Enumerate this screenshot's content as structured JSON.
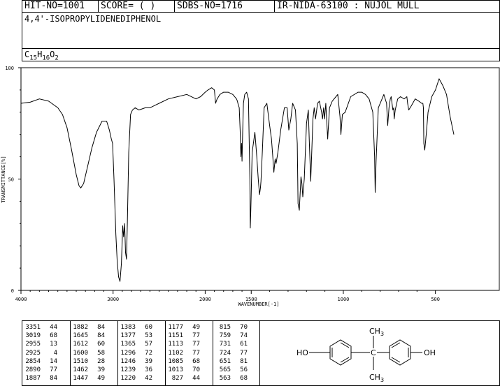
{
  "header": {
    "hit_no": "HIT-NO=1001",
    "score": "SCORE=  (   )",
    "sdbs_no": "SDBS-NO=1716",
    "ir_id": "IR-NIDA-63100 : NUJOL MULL"
  },
  "compound": {
    "name": "4,4'-ISOPROPYLIDENEDIPHENOL",
    "formula_main": "C",
    "formula_sub1": "15",
    "formula_h": "H",
    "formula_sub2": "16",
    "formula_o": "O",
    "formula_sub3": "2"
  },
  "chart_data": {
    "type": "line",
    "xlabel": "WAVENUMBER[-1]",
    "ylabel": "TRANSMITTANCE[%]",
    "xlim": [
      4000,
      400
    ],
    "ylim": [
      0,
      100
    ],
    "x_ticks": [
      4000,
      3000,
      2000,
      1500,
      1000,
      500
    ],
    "y_ticks": [
      0,
      50,
      100
    ],
    "x_tick_labels": [
      "4000",
      "3000",
      "2000",
      "1500",
      "1000",
      "500"
    ],
    "y_tick_labels": [
      "0",
      "50",
      "100"
    ],
    "series": [
      {
        "x": [
          4000,
          3900,
          3800,
          3700,
          3600,
          3550,
          3500,
          3450,
          3400,
          3370,
          3351,
          3320,
          3280,
          3230,
          3180,
          3120,
          3070,
          3040,
          3019,
          3005,
          2990,
          2970,
          2955,
          2940,
          2925,
          2910,
          2895,
          2885,
          2875,
          2865,
          2854,
          2845,
          2830,
          2810,
          2790,
          2760,
          2720,
          2650,
          2600,
          2550,
          2500,
          2400,
          2300,
          2200,
          2100,
          2050,
          2000,
          1970,
          1930,
          1900,
          1887,
          1870,
          1840,
          1800,
          1750,
          1700,
          1660,
          1650,
          1645,
          1630,
          1620,
          1612,
          1605,
          1600,
          1595,
          1585,
          1570,
          1550,
          1530,
          1515,
          1510,
          1505,
          1495,
          1480,
          1470,
          1462,
          1455,
          1450,
          1447,
          1440,
          1430,
          1415,
          1400,
          1390,
          1383,
          1377,
          1370,
          1365,
          1355,
          1340,
          1320,
          1305,
          1296,
          1285,
          1275,
          1260,
          1250,
          1246,
          1239,
          1230,
          1225,
          1220,
          1212,
          1200,
          1190,
          1185,
          1177,
          1165,
          1158,
          1151,
          1140,
          1130,
          1118,
          1113,
          1107,
          1102,
          1095,
          1085,
          1075,
          1060,
          1040,
          1030,
          1018,
          1013,
          1005,
          990,
          960,
          920,
          900,
          880,
          860,
          840,
          830,
          827,
          822,
          810,
          790,
          780,
          765,
          759,
          752,
          745,
          740,
          731,
          726,
          724,
          718,
          705,
          690,
          670,
          655,
          651,
          645,
          630,
          610,
          590,
          575,
          568,
          565,
          563,
          558,
          550,
          540,
          520,
          500,
          480,
          460,
          440,
          420,
          400
        ],
        "y": [
          84,
          84.5,
          86,
          85,
          82,
          79,
          73,
          63,
          52,
          47,
          46,
          48,
          55,
          64,
          71,
          76,
          76,
          72,
          68,
          66,
          50,
          25,
          13,
          6,
          4,
          12,
          29,
          24,
          30,
          17,
          14,
          30,
          62,
          79,
          81,
          82,
          81,
          82,
          82,
          83,
          84,
          86,
          87,
          88,
          86,
          87,
          89,
          90,
          91,
          90,
          84,
          86,
          88,
          89,
          89,
          88,
          86,
          85,
          84,
          82,
          72,
          60,
          66,
          58,
          67,
          84,
          88,
          89,
          86,
          50,
          28,
          35,
          62,
          71,
          60,
          50,
          43,
          46,
          49,
          62,
          82,
          84,
          74,
          68,
          60,
          53,
          59,
          57,
          62,
          72,
          82,
          82,
          72,
          77,
          84,
          81,
          66,
          39,
          36,
          51,
          48,
          42,
          50,
          75,
          81,
          68,
          49,
          77,
          82,
          77,
          84,
          85,
          80,
          77,
          82,
          77,
          84,
          68,
          82,
          85,
          87,
          88,
          78,
          70,
          79,
          80,
          87,
          89,
          89,
          88,
          86,
          80,
          60,
          44,
          58,
          82,
          86,
          88,
          84,
          74,
          82,
          86,
          87,
          81,
          82,
          77,
          81,
          86,
          87,
          86,
          87,
          84,
          81,
          83,
          86,
          85,
          84,
          84,
          82,
          66,
          63,
          70,
          80,
          87,
          90,
          95,
          92,
          88,
          78,
          70
        ]
      }
    ],
    "peak_table": [
      [
        [
          "3351",
          "44"
        ],
        [
          "3019",
          "68"
        ],
        [
          "2955",
          "13"
        ],
        [
          "2925",
          "4"
        ],
        [
          "2854",
          "14"
        ],
        [
          "2890",
          "77"
        ],
        [
          "1887",
          "84"
        ]
      ],
      [
        [
          "1882",
          "84"
        ],
        [
          "1645",
          "84"
        ],
        [
          "1612",
          "60"
        ],
        [
          "1600",
          "58"
        ],
        [
          "1510",
          "28"
        ],
        [
          "1462",
          "39"
        ],
        [
          "1447",
          "49"
        ]
      ],
      [
        [
          "1383",
          "60"
        ],
        [
          "1377",
          "53"
        ],
        [
          "1365",
          "57"
        ],
        [
          "1296",
          "72"
        ],
        [
          "1246",
          "39"
        ],
        [
          "1239",
          "36"
        ],
        [
          "1220",
          "42"
        ]
      ],
      [
        [
          "1177",
          "49"
        ],
        [
          "1151",
          "77"
        ],
        [
          "1113",
          "77"
        ],
        [
          "1102",
          "77"
        ],
        [
          "1085",
          "68"
        ],
        [
          "1013",
          "70"
        ],
        [
          "827",
          "44"
        ]
      ],
      [
        [
          "815",
          "70"
        ],
        [
          "759",
          "74"
        ],
        [
          "731",
          "61"
        ],
        [
          "724",
          "77"
        ],
        [
          "651",
          "81"
        ],
        [
          "565",
          "56"
        ],
        [
          "563",
          "68"
        ]
      ]
    ]
  },
  "structure": {
    "ho": "HO",
    "oh": "OH",
    "ch3_top": "CH",
    "ch3_top_sub": "3",
    "ch3_bottom": "CH",
    "ch3_bottom_sub": "3",
    "carbon": "C"
  }
}
